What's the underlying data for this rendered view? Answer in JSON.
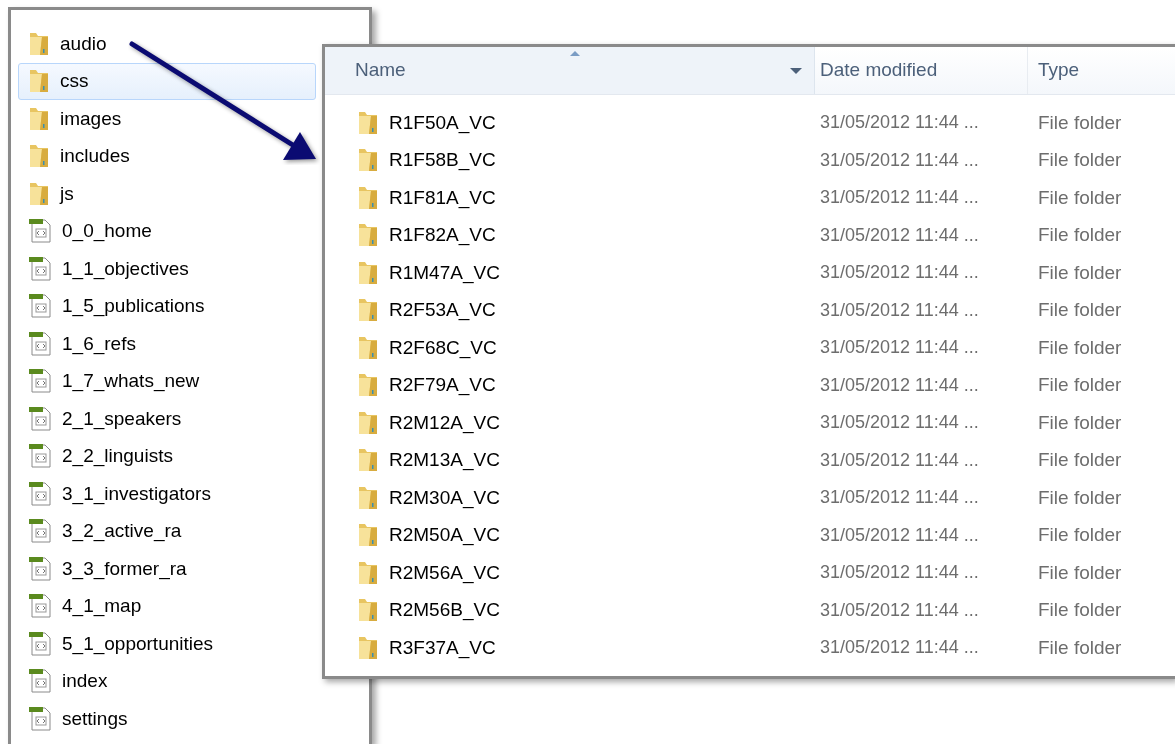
{
  "left_pane": {
    "items": [
      {
        "label": "audio",
        "kind": "folder",
        "selected": false
      },
      {
        "label": "css",
        "kind": "folder",
        "selected": true
      },
      {
        "label": "images",
        "kind": "folder",
        "selected": false
      },
      {
        "label": "includes",
        "kind": "folder",
        "selected": false
      },
      {
        "label": "js",
        "kind": "folder",
        "selected": false
      },
      {
        "label": "0_0_home",
        "kind": "html",
        "selected": false
      },
      {
        "label": "1_1_objectives",
        "kind": "html",
        "selected": false
      },
      {
        "label": "1_5_publications",
        "kind": "html",
        "selected": false
      },
      {
        "label": "1_6_refs",
        "kind": "html",
        "selected": false
      },
      {
        "label": "1_7_whats_new",
        "kind": "html",
        "selected": false
      },
      {
        "label": "2_1_speakers",
        "kind": "html",
        "selected": false
      },
      {
        "label": "2_2_linguists",
        "kind": "html",
        "selected": false
      },
      {
        "label": "3_1_investigators",
        "kind": "html",
        "selected": false
      },
      {
        "label": "3_2_active_ra",
        "kind": "html",
        "selected": false
      },
      {
        "label": "3_3_former_ra",
        "kind": "html",
        "selected": false
      },
      {
        "label": "4_1_map",
        "kind": "html",
        "selected": false
      },
      {
        "label": "5_1_opportunities",
        "kind": "html",
        "selected": false
      },
      {
        "label": "index",
        "kind": "html",
        "selected": false
      },
      {
        "label": "settings",
        "kind": "html",
        "selected": false
      }
    ]
  },
  "right_pane": {
    "columns": [
      "Name",
      "Date modified",
      "Type"
    ],
    "rows": [
      {
        "name": "R1F50A_VC",
        "date": "31/05/2012 11:44 ...",
        "type": "File folder"
      },
      {
        "name": "R1F58B_VC",
        "date": "31/05/2012 11:44 ...",
        "type": "File folder"
      },
      {
        "name": "R1F81A_VC",
        "date": "31/05/2012 11:44 ...",
        "type": "File folder"
      },
      {
        "name": "R1F82A_VC",
        "date": "31/05/2012 11:44 ...",
        "type": "File folder"
      },
      {
        "name": "R1M47A_VC",
        "date": "31/05/2012 11:44 ...",
        "type": "File folder"
      },
      {
        "name": "R2F53A_VC",
        "date": "31/05/2012 11:44 ...",
        "type": "File folder"
      },
      {
        "name": "R2F68C_VC",
        "date": "31/05/2012 11:44 ...",
        "type": "File folder"
      },
      {
        "name": "R2F79A_VC",
        "date": "31/05/2012 11:44 ...",
        "type": "File folder"
      },
      {
        "name": "R2M12A_VC",
        "date": "31/05/2012 11:44 ...",
        "type": "File folder"
      },
      {
        "name": "R2M13A_VC",
        "date": "31/05/2012 11:44 ...",
        "type": "File folder"
      },
      {
        "name": "R2M30A_VC",
        "date": "31/05/2012 11:44 ...",
        "type": "File folder"
      },
      {
        "name": "R2M50A_VC",
        "date": "31/05/2012 11:44 ...",
        "type": "File folder"
      },
      {
        "name": "R2M56A_VC",
        "date": "31/05/2012 11:44 ...",
        "type": "File folder"
      },
      {
        "name": "R2M56B_VC",
        "date": "31/05/2012 11:44 ...",
        "type": "File folder"
      },
      {
        "name": "R3F37A_VC",
        "date": "31/05/2012 11:44 ...",
        "type": "File folder"
      }
    ]
  }
}
